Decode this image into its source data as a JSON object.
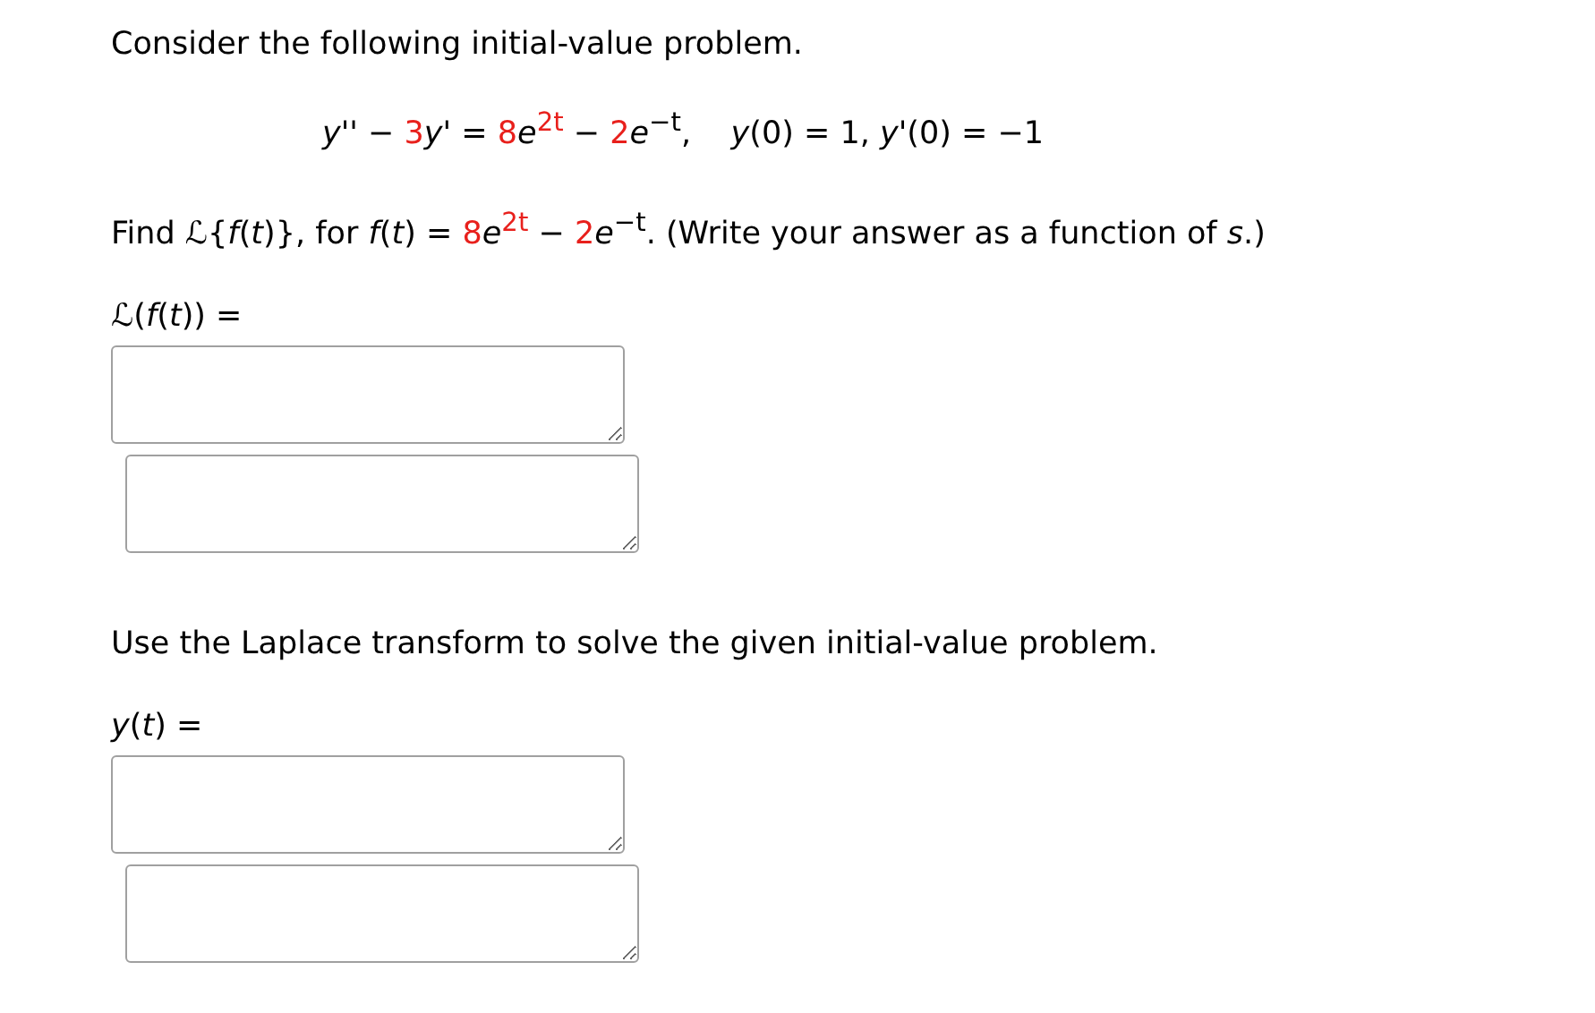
{
  "intro": "Consider the following initial-value problem.",
  "equation": [
    {
      "text": "*y*'' − ",
      "highlight": false
    },
    {
      "text": "3",
      "highlight": true
    },
    {
      "text": "*y*' = ",
      "highlight": false
    },
    {
      "text": "8",
      "highlight": true
    },
    {
      "text": "*e*",
      "highlight": false
    },
    {
      "text": "$^{2t}$",
      "highlight": true
    },
    {
      "text": " − ",
      "highlight": false
    },
    {
      "text": "2",
      "highlight": true
    },
    {
      "text": "*e*$^{−t}$,    *y*(0) = 1, *y*'(0) = −1",
      "highlight": false
    }
  ],
  "question_1": [
    {
      "text": "Find ℒ{*f*(*t*)}, for *f*(*t*) = ",
      "highlight": false
    },
    {
      "text": "8",
      "highlight": true
    },
    {
      "text": "*e*",
      "highlight": false
    },
    {
      "text": "$^{2t}$",
      "highlight": true
    },
    {
      "text": " − ",
      "highlight": false
    },
    {
      "text": "2",
      "highlight": true
    },
    {
      "text": "*e*$^{−t}$. (Write your answer as a function of *s*.)",
      "highlight": false
    }
  ],
  "answer_1_label": "ℒ(*f*(*t*)) =",
  "question_2": "Use the Laplace transform to solve the given initial-value problem.",
  "answer_2_label": "*y*(*t*) ="
}
